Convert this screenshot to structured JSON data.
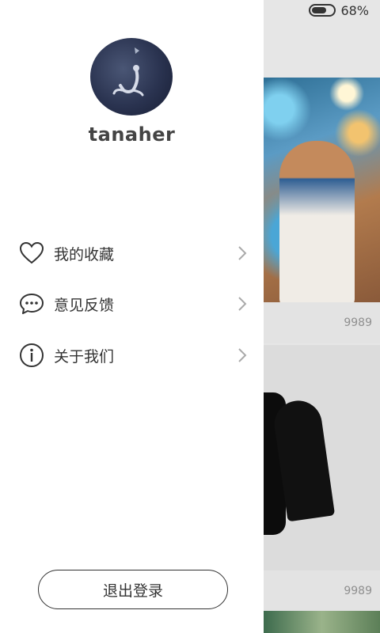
{
  "status_bar": {
    "battery_percent": "68%",
    "battery_level": 0.68
  },
  "drawer": {
    "username": "tanaher",
    "menu": [
      {
        "label": "我的收藏",
        "icon": "heart-icon"
      },
      {
        "label": "意见反馈",
        "icon": "chat-bubble-icon"
      },
      {
        "label": "关于我们",
        "icon": "info-icon"
      }
    ],
    "logout_label": "退出登录"
  },
  "feed": {
    "cards": [
      {
        "count": "9989"
      },
      {
        "count": "9989"
      }
    ]
  }
}
